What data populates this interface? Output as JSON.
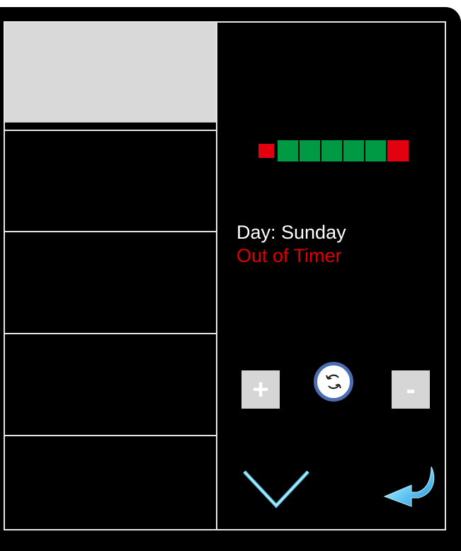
{
  "status": {
    "day_text": "Day: Sunday",
    "timer_text": "Out of Timer"
  },
  "menu": {
    "items": [
      {
        "label": "",
        "selected": true
      },
      {
        "label": "",
        "selected": false
      },
      {
        "label": "",
        "selected": false
      },
      {
        "label": "",
        "selected": false
      },
      {
        "label": "",
        "selected": false
      }
    ]
  },
  "indicator": {
    "segments": [
      "red-small",
      "green",
      "green",
      "green",
      "green",
      "green",
      "red"
    ],
    "colors": {
      "red": "#e3000f",
      "green": "#009a44"
    }
  },
  "controls": {
    "plus_label": "+",
    "minus_label": "-",
    "refresh_icon": "refresh-icon",
    "down_icon": "chevron-down-icon",
    "back_icon": "back-arrow-icon"
  },
  "colors": {
    "background": "#000000",
    "border": "#e6e6e6",
    "selected_item": "#d9d9d9",
    "button": "#d6d6d6",
    "refresh_ring": "#4a6eb0",
    "accent_blue": "#5bc8ef"
  }
}
